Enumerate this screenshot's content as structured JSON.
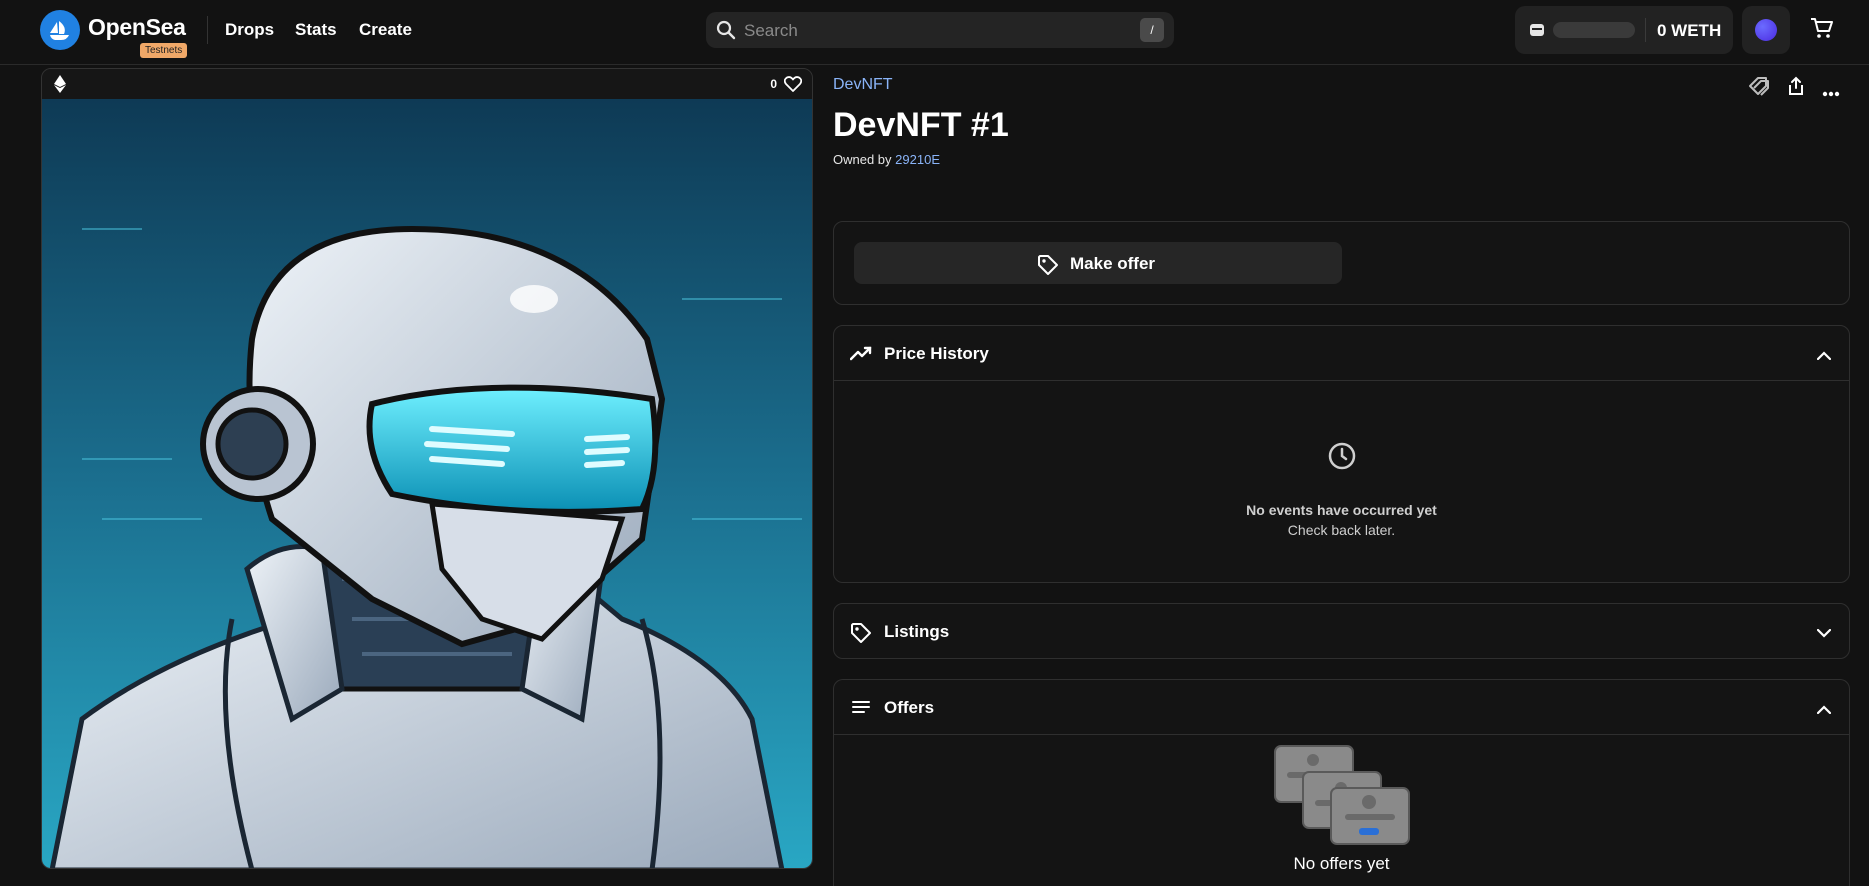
{
  "header": {
    "brand": "OpenSea",
    "badge": "Testnets",
    "nav": [
      "Drops",
      "Stats",
      "Create"
    ],
    "search": {
      "placeholder": "Search",
      "shortcut": "/"
    },
    "wallet": {
      "balance": "0 WETH"
    }
  },
  "media": {
    "likes": "0",
    "chain_icon": "ethereum-icon"
  },
  "item": {
    "collection": "DevNFT",
    "title": "DevNFT #1",
    "owned_prefix": "Owned by",
    "owner": "29210E"
  },
  "actions": {
    "make_offer": "Make offer"
  },
  "sections": {
    "price_history": {
      "label": "Price History",
      "empty_title": "No events have occurred yet",
      "empty_sub": "Check back later."
    },
    "listings": {
      "label": "Listings"
    },
    "offers": {
      "label": "Offers",
      "empty": "No offers yet"
    }
  },
  "colors": {
    "accent": "#2081e2",
    "link": "#8ab4f8",
    "background": "#121212",
    "badge": "#f0a868"
  }
}
